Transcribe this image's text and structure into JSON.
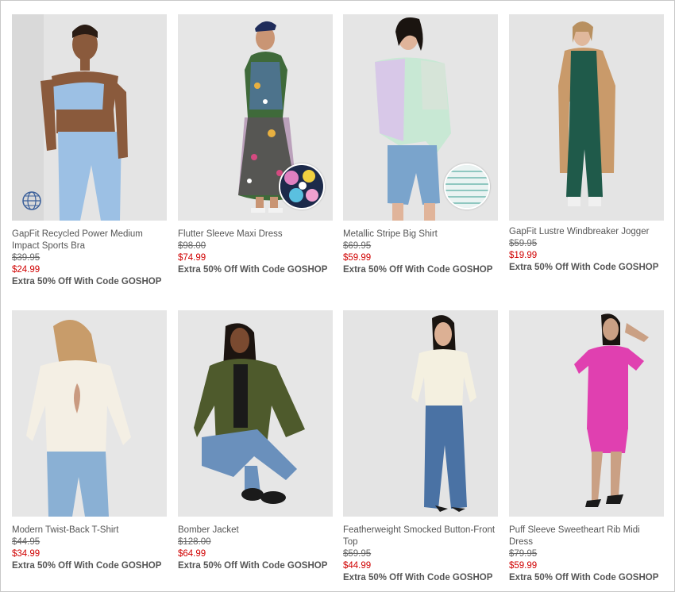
{
  "products": [
    {
      "name": "GapFit Recycled Power Medium Impact Sports Bra",
      "original_price": "$39.95",
      "sale_price": "$24.99",
      "promo": "Extra 50% Off With Code GOSHOP"
    },
    {
      "name": "Flutter Sleeve Maxi Dress",
      "original_price": "$98.00",
      "sale_price": "$74.99",
      "promo": "Extra 50% Off With Code GOSHOP"
    },
    {
      "name": "Metallic Stripe Big Shirt",
      "original_price": "$69.95",
      "sale_price": "$59.99",
      "promo": "Extra 50% Off With Code GOSHOP"
    },
    {
      "name": "GapFit Lustre Windbreaker Jogger",
      "original_price": "$59.95",
      "sale_price": "$19.99",
      "promo": "Extra 50% Off With Code GOSHOP"
    },
    {
      "name": "Modern Twist-Back T-Shirt",
      "original_price": "$44.95",
      "sale_price": "$34.99",
      "promo": "Extra 50% Off With Code GOSHOP"
    },
    {
      "name": "Bomber Jacket",
      "original_price": "$128.00",
      "sale_price": "$64.99",
      "promo": "Extra 50% Off With Code GOSHOP"
    },
    {
      "name": "Featherweight Smocked Button-Front Top",
      "original_price": "$59.95",
      "sale_price": "$44.99",
      "promo": "Extra 50% Off With Code GOSHOP"
    },
    {
      "name": "Puff Sleeve Sweetheart Rib Midi Dress",
      "original_price": "$79.95",
      "sale_price": "$59.99",
      "promo": "Extra 50% Off With Code GOSHOP"
    }
  ],
  "icons": {
    "sustainability": "globe-icon",
    "color_swatch": "fabric-swatch-icon"
  },
  "colors": {
    "sale_price": "#d00000",
    "text": "#555555"
  }
}
